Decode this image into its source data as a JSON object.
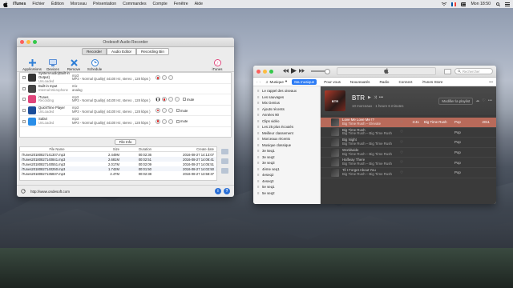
{
  "menubar": {
    "app": "iTunes",
    "items": [
      "Fichier",
      "Édition",
      "Morceau",
      "Présentation",
      "Commandes",
      "Compte",
      "Fenêtre",
      "Aide"
    ],
    "clock": "Mon 18:50"
  },
  "recorder": {
    "title": "Ondesoft Audio Recorder",
    "tabs": [
      "Recorder",
      "Audio Editor",
      "Recording Bin"
    ],
    "toolbar": [
      "Applications",
      "Devices",
      "Remove",
      "Schedule"
    ],
    "itunes_label": "iTunes",
    "sources": [
      {
        "name": "SystemAudio(Built-in Output)",
        "status": "UnLoaded",
        "format": "mp3",
        "format2": "MP3 - Normal Quality( 44100 Hz, stereo , 128 kbps )",
        "mute": "",
        "color": "#333333"
      },
      {
        "name": "Built-in Input",
        "status": "Internal Microphone",
        "format": "mix",
        "format2": "analog",
        "mute": "",
        "color": "#444444"
      },
      {
        "name": "iTunes",
        "status": "Recording",
        "format": "mp3",
        "format2": "MP3 - Normal Quality( 44100 Hz, stereo , 128 kbps )",
        "mute": "mute",
        "color": "#e0457b"
      },
      {
        "name": "QuickTime Player",
        "status": "UnLoaded",
        "format": "mp3",
        "format2": "MP3 - Normal Quality( 44100 Hz, stereo , 128 kbps )",
        "mute": "mute",
        "color": "#1a4d9a"
      },
      {
        "name": "Safari",
        "status": "UnLoaded",
        "format": "mp3",
        "format2": "MP3 - Normal Quality( 44100 Hz, stereo , 128 kbps )",
        "mute": "mute",
        "color": "#2a8ee8"
      }
    ],
    "file_info_label": "File Info",
    "file_headers": [
      "File Name",
      "Size",
      "Duration",
      "Create date"
    ],
    "files": [
      [
        "iTunes20180827141307.mp3",
        "2.449M",
        "00:02:36",
        "2016-08-27 14:13:07"
      ],
      [
        "iTunes20180827140841.mp3",
        "2.681M",
        "00:02:51",
        "2016-08-27 14:08:41"
      ],
      [
        "iTunes20180827140551.mp3",
        "2.017M",
        "00:02:09",
        "2016-08-27 14:05:51"
      ],
      [
        "iTunes20180827140250.mp3",
        "1.742M",
        "00:01:50",
        "2016-08-27 14:02:50"
      ],
      [
        "iTunes20180827135837.mp3",
        "2.47M",
        "00:02:38",
        "2016-08-27 13:58:37"
      ]
    ],
    "url": "http://www.ondesoft.com"
  },
  "itunes": {
    "search_placeholder": "Rechercher",
    "media": "Musique",
    "tabs": [
      "Ma musique",
      "Pour vous",
      "Nouveautés",
      "Radio",
      "Connect",
      "iTunes Store"
    ],
    "sidebar": [
      "Le rappel des oiseaux",
      "Les sauvages",
      "Mix Genius",
      "Ajouts récents",
      "Années 90",
      "Clips vidéo",
      "Les 25 plus écoutés",
      "Meilleur classement",
      "Morceaux récents",
      "Musique classique",
      "3e 5eq1",
      "3e seq2",
      "3e seq3",
      "4ème seq1",
      "4eseq2",
      "4eseq3",
      "5e seq1",
      "5e seq2"
    ],
    "playlist": {
      "cover_text": "BTR",
      "title": "BTR",
      "sub": "10 morceaux · 1 heure 6 minutes",
      "show_btn": "Modifier la playlist"
    },
    "tracks": [
      {
        "title": "Love Me Love Me !?",
        "artist": "Big Time Rush – Elevate",
        "dur": "3:41",
        "art": "Big Time Rush",
        "alb": "Pop",
        "gen": "2011"
      },
      {
        "title": "Big Time Rush",
        "artist": "Big Time Rush – Big Time Rush",
        "dur": "",
        "art": "",
        "alb": "Pop",
        "gen": ""
      },
      {
        "title": "Big Night",
        "artist": "Big Time Rush – Big Time Rush",
        "dur": "",
        "art": "",
        "alb": "Pop",
        "gen": ""
      },
      {
        "title": "Worldwide",
        "artist": "Big Time Rush – Big Time Rush",
        "dur": "",
        "art": "",
        "alb": "Pop",
        "gen": ""
      },
      {
        "title": "Halfway There",
        "artist": "Big Time Rush – Big Time Rush",
        "dur": "",
        "art": "",
        "alb": "Pop",
        "gen": ""
      },
      {
        "title": "Til I Forget About You",
        "artist": "Big Time Rush – Big Time Rush",
        "dur": "",
        "art": "",
        "alb": "Pop",
        "gen": ""
      }
    ]
  }
}
